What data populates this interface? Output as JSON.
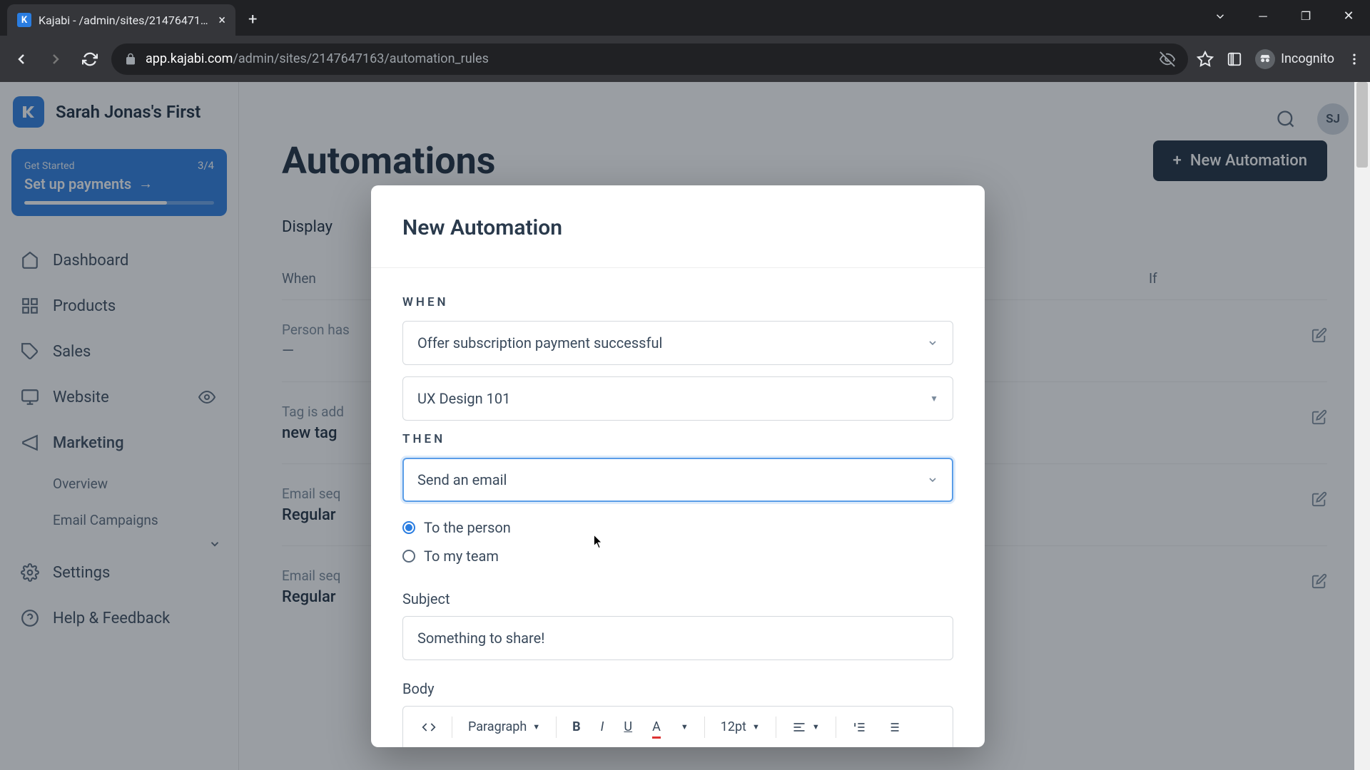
{
  "browser": {
    "tab_title": "Kajabi - /admin/sites/2147647163",
    "url_domain": "app.kajabi.com",
    "url_path": "/admin/sites/2147647163/automation_rules",
    "incognito_label": "Incognito"
  },
  "brand": {
    "title": "Sarah Jonas's First",
    "logo_letter": "K"
  },
  "get_started": {
    "label": "Get Started",
    "count": "3/4",
    "title": "Set up payments"
  },
  "nav": {
    "dashboard": "Dashboard",
    "products": "Products",
    "sales": "Sales",
    "website": "Website",
    "marketing": "Marketing",
    "overview": "Overview",
    "email_campaigns": "Email Campaigns",
    "settings": "Settings",
    "help": "Help & Feedback"
  },
  "topbar": {
    "avatar": "SJ"
  },
  "page": {
    "title": "Automations",
    "new_btn": "New Automation",
    "display": "Display",
    "col_when": "When",
    "col_if": "If"
  },
  "rows": [
    {
      "title": "Person has",
      "sub": "—"
    },
    {
      "title": "Tag is add",
      "sub": "new tag"
    },
    {
      "title": "Email seq",
      "sub": "Regular"
    },
    {
      "title": "Email seq",
      "sub": "Regular"
    }
  ],
  "modal": {
    "title": "New Automation",
    "when_label": "WHEN",
    "when_value": "Offer subscription payment successful",
    "when_offer": "UX Design 101",
    "then_label": "THEN",
    "then_value": "Send an email",
    "radio_person": "To the person",
    "radio_team": "To my team",
    "subject_label": "Subject",
    "subject_value": "Something to share!",
    "body_label": "Body",
    "para_label": "Paragraph",
    "font_size": "12pt"
  }
}
